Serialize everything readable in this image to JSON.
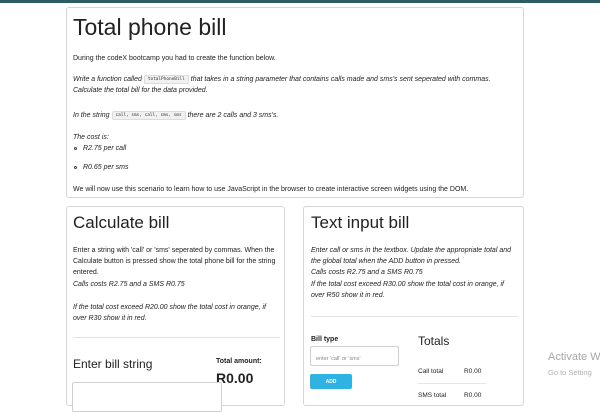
{
  "intro": {
    "title": "Total phone bill",
    "lead": "During the codeX bootcamp you had to create the function below.",
    "task_pre": "Write a function called ",
    "task_code": "totalPhoneBill",
    "task_post": " that takes in a string parameter that contains calls made and sms's sent seperated with commas.",
    "task_line2": "Calculate the total bill for the data provided.",
    "example_pre": "In the string ",
    "example_code": "call, sms, call, sms, sms",
    "example_post": " there are 2 calls and 3 sms's.",
    "cost_label": "The cost is:",
    "costs": [
      "R2.75 per call",
      "R0.65 per sms"
    ],
    "outro": "We will now use this scenario to learn how to use JavaScript in the browser to create interactive screen widgets using the DOM."
  },
  "calculate_bill": {
    "title": "Calculate bill",
    "desc_lines": [
      "Enter a string with 'call' or 'sms' seperated by commas. When the",
      "Calculate button is pressed show the total phone bill for the string",
      "entered."
    ],
    "cost_note": "Calls costs R2.75 and a SMS R0.75",
    "warning_lines": [
      "If the total cost exceed R20.00 show the total cost in orange, if",
      "over R30 show it in red."
    ],
    "input_label": "Enter bill string",
    "total_label": "Total amount:",
    "total_value": "R0.00",
    "input_value": ""
  },
  "text_input_bill": {
    "title": "Text input bill",
    "desc_lines": [
      "Enter call or sms in the textbox. Update the appropriate total and",
      "the global total when the ADD button in pressed."
    ],
    "cost_note": "Calls costs R2.75 and a SMS R0.75",
    "warning_lines": [
      "If the total cost exceed R30.00 show the total cost in orange, if",
      "over R50 show it in red."
    ],
    "bill_type_label": "Bill type",
    "bill_type_placeholder": "enter 'call' or 'sms'",
    "bill_type_value": "",
    "add_label": "ADD",
    "totals_title": "Totals",
    "totals_rows": [
      {
        "label": "Call total",
        "value": "R0.00"
      },
      {
        "label": "SMS total",
        "value": "R0.00"
      }
    ]
  },
  "watermark": {
    "line1": "Activate W",
    "line2": "Go to Setting"
  },
  "colors": {
    "topbar": "#2b5d63",
    "add_button": "#2fb3e3",
    "panel_border": "#d6d6d6"
  }
}
